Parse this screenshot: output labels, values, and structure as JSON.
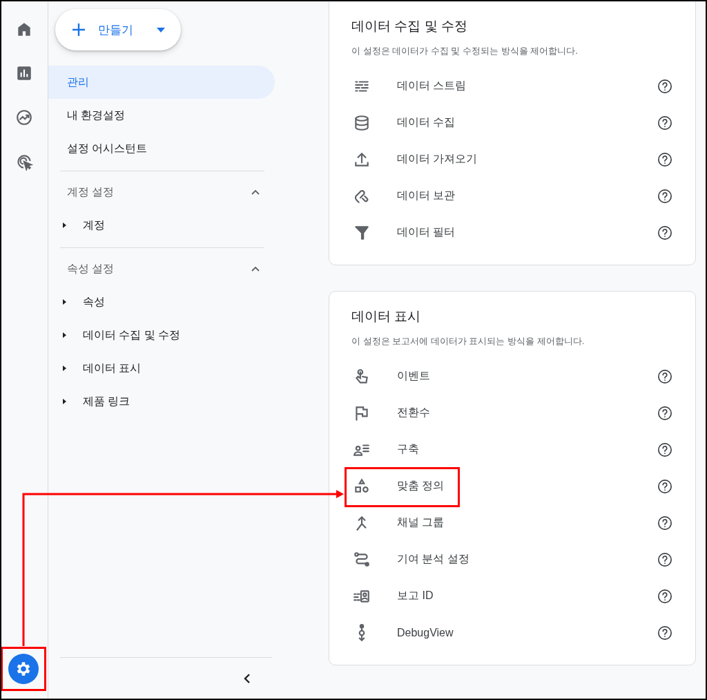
{
  "rail": {
    "items": [
      {
        "kind": "home",
        "selected": false
      },
      {
        "kind": "reports",
        "selected": false
      },
      {
        "kind": "explore",
        "selected": false
      },
      {
        "kind": "advertising",
        "selected": false
      }
    ],
    "admin": {
      "selected": true,
      "annotated": true
    }
  },
  "nav": {
    "create_button": {
      "label": "만들기"
    },
    "items": [
      {
        "label": "관리",
        "selected": true
      },
      {
        "label": "내 환경설정",
        "selected": false
      },
      {
        "label": "설정 어시스턴트",
        "selected": false
      }
    ],
    "sections": [
      {
        "title": "계정 설정",
        "expanded": true,
        "items": [
          {
            "label": "계정",
            "expanded": false
          }
        ]
      },
      {
        "title": "속성 설정",
        "expanded": true,
        "items": [
          {
            "label": "속성",
            "expanded": false
          },
          {
            "label": "데이터 수집 및 수정",
            "expanded": false
          },
          {
            "label": "데이터 표시",
            "expanded": false
          },
          {
            "label": "제품 링크",
            "expanded": false
          }
        ]
      }
    ]
  },
  "cards": [
    {
      "title": "데이터 수집 및 수정",
      "description": "이 설정은 데이터가 수집 및 수정되는 방식을 제어합니다.",
      "items": [
        {
          "kind": "streams",
          "label": "데이터 스트림",
          "annotated": false
        },
        {
          "kind": "database",
          "label": "데이터 수집",
          "annotated": false
        },
        {
          "kind": "upload",
          "label": "데이터 가져오기",
          "annotated": false
        },
        {
          "kind": "retention",
          "label": "데이터 보관",
          "annotated": false
        },
        {
          "kind": "filter",
          "label": "데이터 필터",
          "annotated": false
        }
      ]
    },
    {
      "title": "데이터 표시",
      "description": "이 설정은 보고서에 데이터가 표시되는 방식을 제어합니다.",
      "items": [
        {
          "kind": "touch",
          "label": "이벤트",
          "annotated": false
        },
        {
          "kind": "flag",
          "label": "전환수",
          "annotated": false
        },
        {
          "kind": "audience",
          "label": "구축",
          "annotated": false
        },
        {
          "kind": "shapes",
          "label": "맞춤 정의",
          "annotated": true
        },
        {
          "kind": "merge",
          "label": "채널 그룹",
          "annotated": false
        },
        {
          "kind": "route",
          "label": "기여 분석 설정",
          "annotated": false
        },
        {
          "kind": "reportid",
          "label": "보고 ID",
          "annotated": false
        },
        {
          "kind": "debug",
          "label": "DebugView",
          "annotated": false
        }
      ]
    }
  ]
}
